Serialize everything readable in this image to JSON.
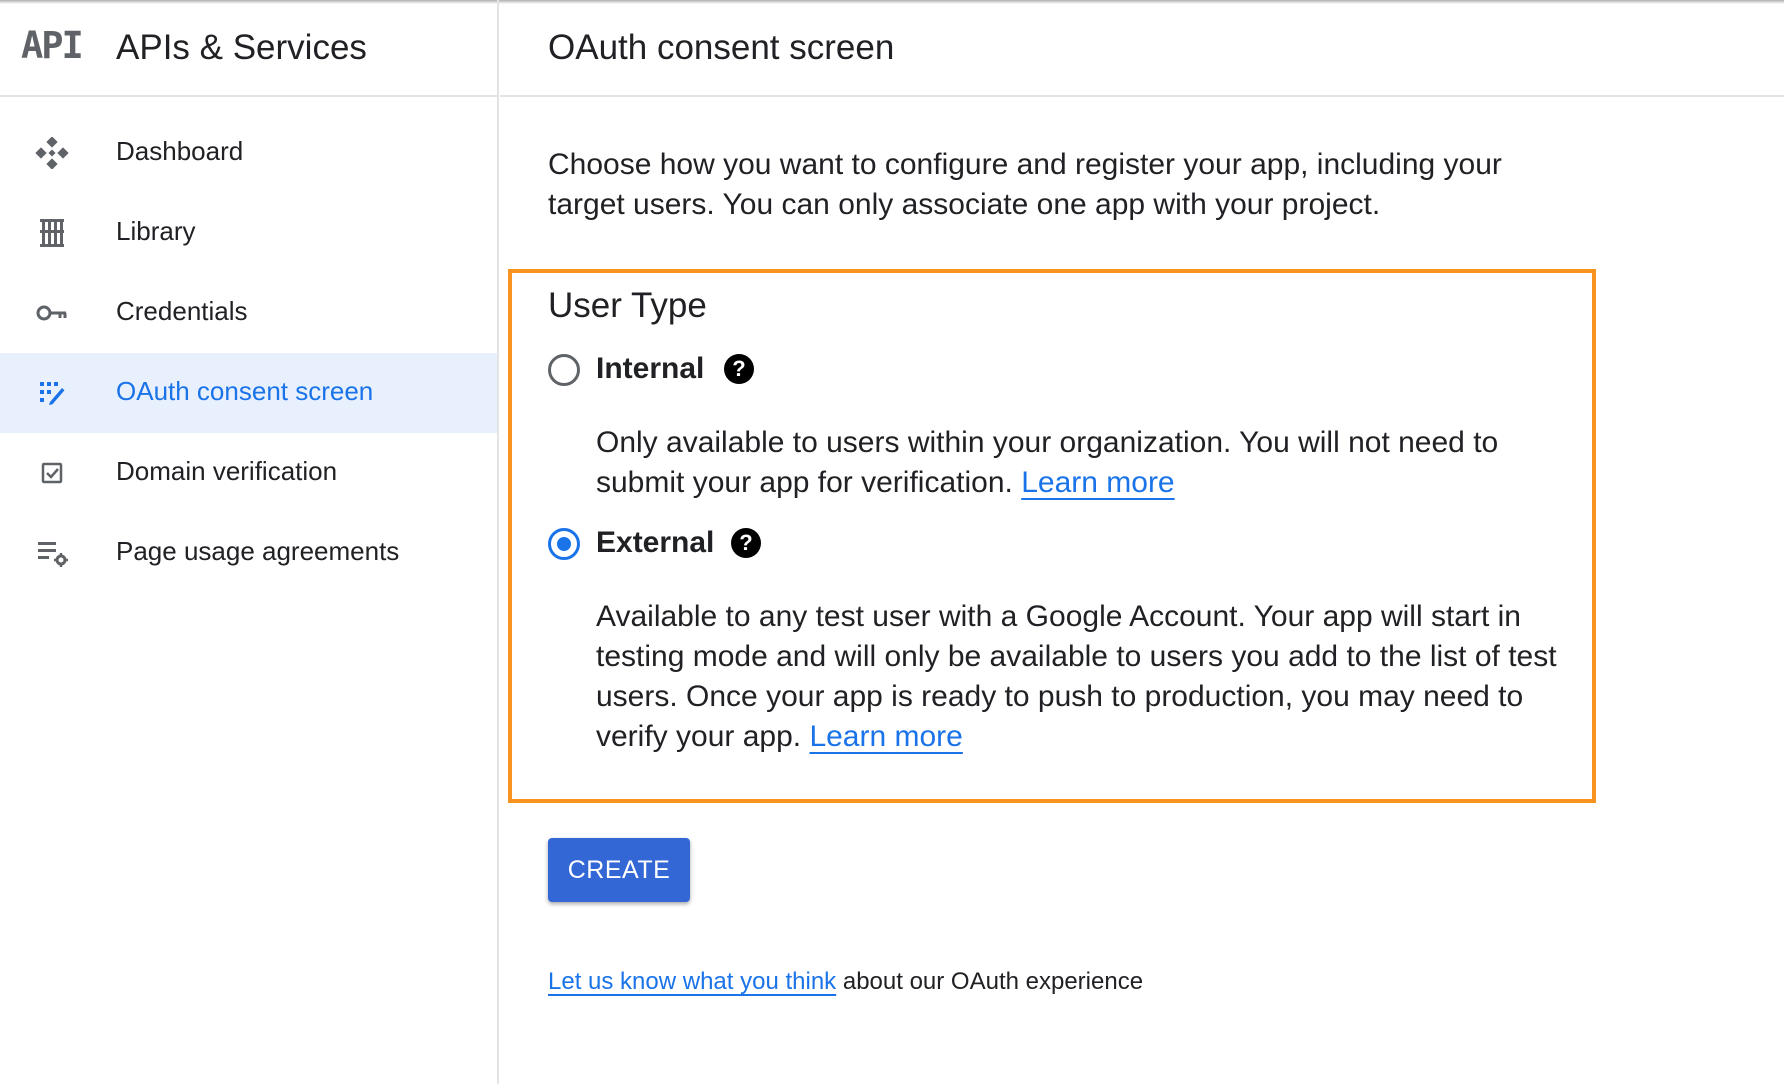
{
  "sidebar": {
    "logo_text": "API",
    "title": "APIs & Services",
    "items": [
      {
        "label": "Dashboard",
        "icon": "dashboard-icon",
        "active": false
      },
      {
        "label": "Library",
        "icon": "library-icon",
        "active": false
      },
      {
        "label": "Credentials",
        "icon": "key-icon",
        "active": false
      },
      {
        "label": "OAuth consent screen",
        "icon": "oauth-consent-icon",
        "active": true
      },
      {
        "label": "Domain verification",
        "icon": "checkbox-icon",
        "active": false
      },
      {
        "label": "Page usage agreements",
        "icon": "list-settings-icon",
        "active": false
      }
    ]
  },
  "main": {
    "title": "OAuth consent screen",
    "intro": "Choose how you want to configure and register your app, including your target users. You can only associate one app with your project.",
    "user_type": {
      "heading": "User Type",
      "internal": {
        "label": "Internal",
        "selected": false,
        "description": "Only available to users within your organization. You will not need to submit your app for verification.",
        "link": "Learn more"
      },
      "external": {
        "label": "External",
        "selected": true,
        "description": "Available to any test user with a Google Account. Your app will start in testing mode and will only be available to users you add to the list of test users. Once your app is ready to push to production, you may need to verify your app.",
        "link": "Learn more"
      },
      "help_glyph": "?"
    },
    "create_label": "CREATE",
    "feedback": {
      "link": "Let us know what you think",
      "text": "about our OAuth experience"
    }
  },
  "colors": {
    "accent": "#1a73e8",
    "button": "#3367d6",
    "highlight_border": "#f7931e",
    "active_bg": "#e8f0fe"
  }
}
